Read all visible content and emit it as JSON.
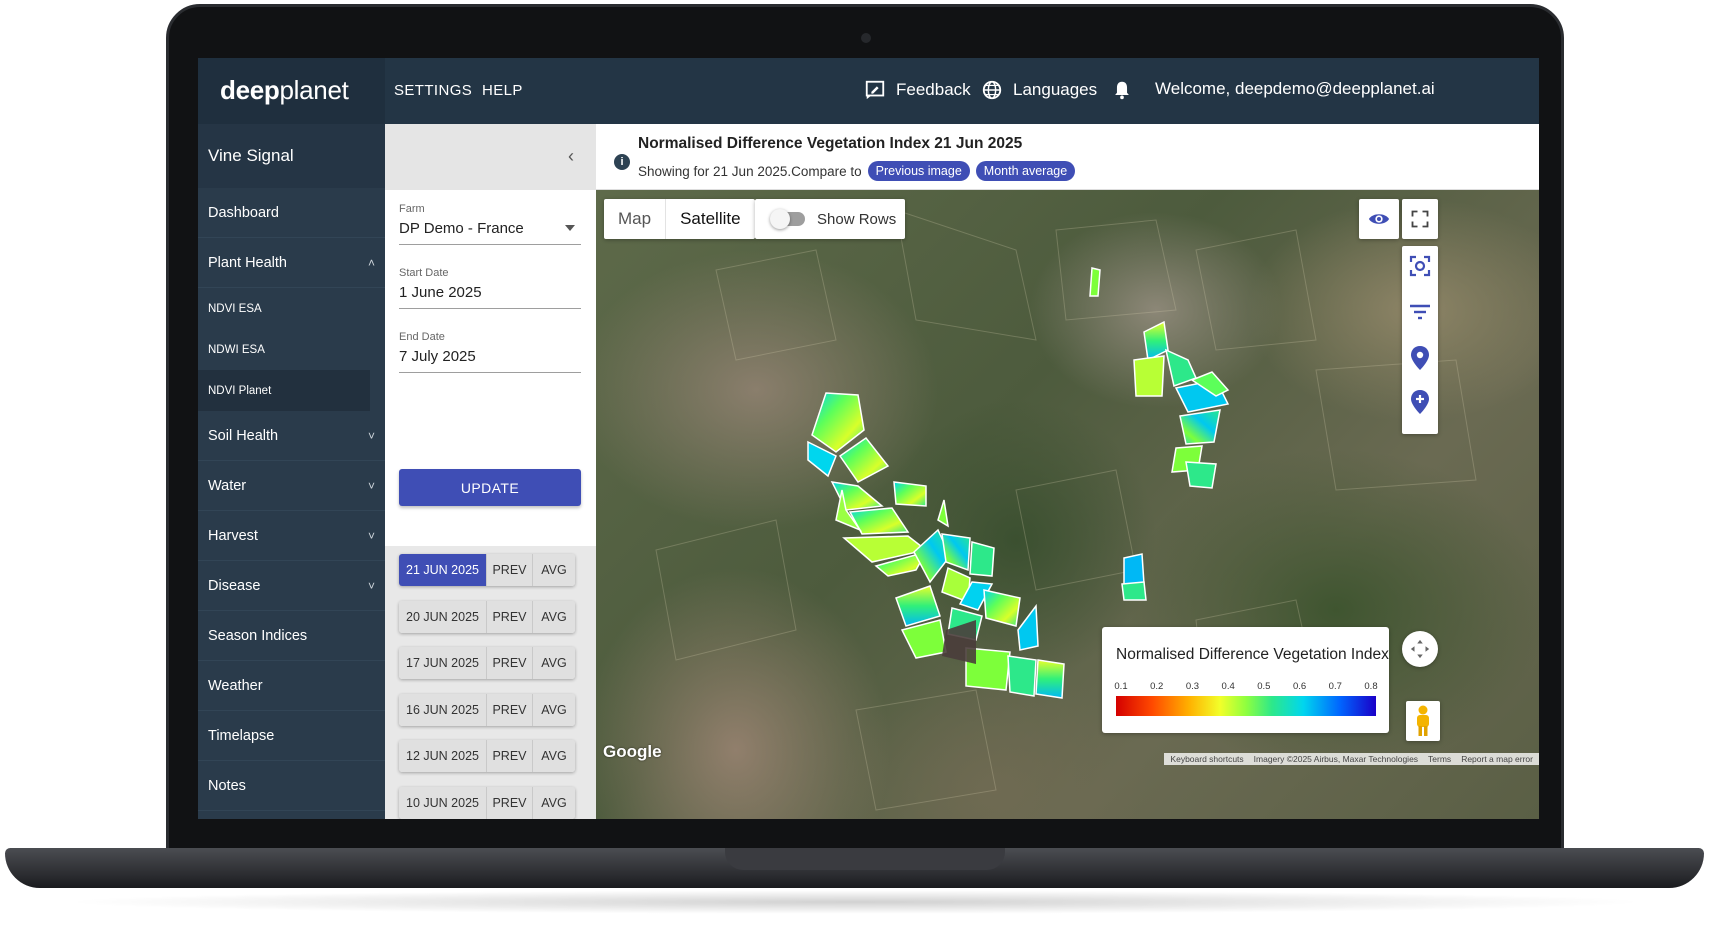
{
  "header": {
    "logo_bold": "deep",
    "logo_light": "planet",
    "nav": [
      "SETTINGS",
      "HELP"
    ],
    "feedback_label": "Feedback",
    "languages_label": "Languages",
    "welcome_text": "Welcome, deepdemo@deepplanet.ai"
  },
  "sidebar": {
    "title": "Vine Signal",
    "items": [
      {
        "label": "Dashboard"
      },
      {
        "label": "Plant Health",
        "chevron": "up"
      },
      {
        "label": "NDVI ESA",
        "sub": true
      },
      {
        "label": "NDWI ESA",
        "sub": true
      },
      {
        "label": "NDVI Planet",
        "sub": true,
        "active": true
      },
      {
        "label": "Soil Health",
        "chevron": "down"
      },
      {
        "label": "Water",
        "chevron": "down"
      },
      {
        "label": "Harvest",
        "chevron": "down"
      },
      {
        "label": "Disease",
        "chevron": "down"
      },
      {
        "label": "Season Indices"
      },
      {
        "label": "Weather"
      },
      {
        "label": "Timelapse"
      },
      {
        "label": "Notes"
      }
    ]
  },
  "filters": {
    "farm_label": "Farm",
    "farm_value": "DP Demo - France",
    "start_label": "Start Date",
    "start_value": "1 June 2025",
    "end_label": "End Date",
    "end_value": "7 July 2025",
    "update_label": "UPDATE"
  },
  "dates": {
    "prev_label": "PREV",
    "avg_label": "AVG",
    "items": [
      "21 JUN 2025",
      "20 JUN 2025",
      "17 JUN 2025",
      "16 JUN 2025",
      "12 JUN 2025",
      "10 JUN 2025"
    ],
    "active_index": 0
  },
  "info": {
    "title": "Normalised Difference Vegetation Index 21 Jun 2025",
    "subtitle": "Showing for 21 Jun 2025.Compare to",
    "previous_label": "Previous image",
    "month_label": "Month average"
  },
  "map": {
    "type_map": "Map",
    "type_satellite": "Satellite",
    "selected_type": "Satellite",
    "show_rows_label": "Show Rows",
    "show_rows_on": false,
    "google_label": "Google",
    "attribution": [
      "Keyboard shortcuts",
      "Imagery ©2025 Airbus, Maxar Technologies",
      "Terms",
      "Report a map error"
    ],
    "tools": [
      "visibility-icon",
      "fullscreen-icon",
      "focus-icon",
      "filter-icon",
      "location-pin-icon",
      "add-location-icon",
      "pan-icon",
      "pegman-icon"
    ]
  },
  "legend": {
    "title": "Normalised Difference Vegetation Index",
    "ticks": [
      "0.1",
      "0.2",
      "0.3",
      "0.4",
      "0.5",
      "0.6",
      "0.7",
      "0.8"
    ]
  },
  "colors": {
    "topbar": "#233545",
    "sidebar": "#2a3b4b",
    "accent": "#3f4eb5"
  }
}
